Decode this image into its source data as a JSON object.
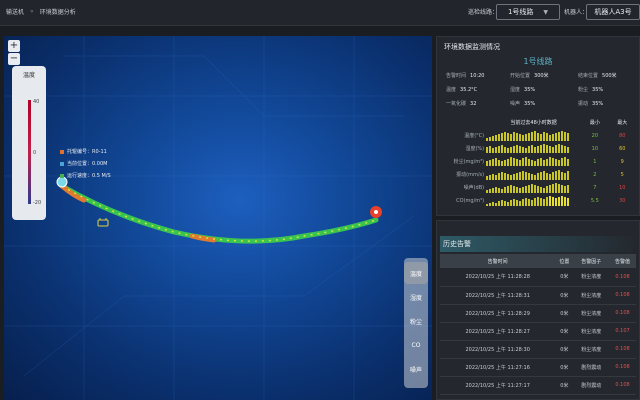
{
  "breadcrumb": {
    "root": "输送机",
    "separator": "»",
    "current": "环境数据分析"
  },
  "header": {
    "route_label": "巡检线路：",
    "route_value": "1号线路",
    "robot_label": "机器人：",
    "robot_value": "机器人A3号"
  },
  "map": {
    "zoom_in": "+",
    "zoom_out": "−",
    "legend": {
      "title": "温度",
      "max": "40",
      "zero": "0",
      "min": "-20"
    },
    "info": [
      {
        "label": "托辊编号：R0-11",
        "color": "#e07030"
      },
      {
        "label": "当前位置：0.00M",
        "color": "#4aa3d8"
      },
      {
        "label": "运行速度：0.5 M/S",
        "color": "#4caf50"
      }
    ],
    "side_buttons": [
      "温度",
      "湿度",
      "粉尘",
      "CO",
      "噪声"
    ],
    "active_button": "温度"
  },
  "monitor": {
    "title": "环境数据监测情况",
    "route": "1号线路",
    "fields": [
      {
        "label": "告警时间",
        "value": "10:20"
      },
      {
        "label": "开始位置",
        "value": "300米"
      },
      {
        "label": "结束位置",
        "value": "500米"
      },
      {
        "label": "温度",
        "value": "35.2°C"
      },
      {
        "label": "湿度",
        "value": "35%"
      },
      {
        "label": "粉尘",
        "value": "35%"
      },
      {
        "label": "一氧化碳",
        "value": "32"
      },
      {
        "label": "噪声",
        "value": "35%"
      },
      {
        "label": "振动",
        "value": "35%"
      }
    ],
    "table_header": {
      "name": "",
      "trend": "当前过去48小时数据",
      "min": "最小",
      "max": "最大"
    },
    "rows": [
      {
        "name": "温度(°C)",
        "min": "20",
        "max": "80",
        "min_color": "#7fbf3a",
        "max_color": "#e04040"
      },
      {
        "name": "湿度(%)",
        "min": "10",
        "max": "60",
        "min_color": "#7fbf3a",
        "max_color": "#e0c030"
      },
      {
        "name": "粉尘(mg/m³)",
        "min": "1",
        "max": "9",
        "min_color": "#7fbf3a",
        "max_color": "#e0c030"
      },
      {
        "name": "振动(mm/s)",
        "min": "2",
        "max": "5",
        "min_color": "#7fbf3a",
        "max_color": "#e0c030"
      },
      {
        "name": "噪声(dB)",
        "min": "7",
        "max": "10",
        "min_color": "#7fbf3a",
        "max_color": "#e04040"
      },
      {
        "name": "CO(mg/m³)",
        "min": "5.5",
        "max": "30",
        "min_color": "#7fbf3a",
        "max_color": "#e04040"
      }
    ]
  },
  "history": {
    "title": "历史告警",
    "columns": [
      "告警时间",
      "位置",
      "告警因子",
      "告警值"
    ],
    "rows": [
      [
        "2022/10/25 上午 11:28:28",
        "0米",
        "粉尘浓度",
        "0.108"
      ],
      [
        "2022/10/25 上午 11:28:31",
        "0米",
        "粉尘浓度",
        "0.108"
      ],
      [
        "2022/10/25 上午 11:28:29",
        "0米",
        "粉尘浓度",
        "0.108"
      ],
      [
        "2022/10/25 上午 11:28:27",
        "0米",
        "粉尘浓度",
        "0.107"
      ],
      [
        "2022/10/25 上午 11:28:30",
        "0米",
        "粉尘浓度",
        "0.108"
      ],
      [
        "2022/10/25 上午 11:27:16",
        "0米",
        "剧烈震动",
        "0.108"
      ],
      [
        "2022/10/25 上午 11:27:17",
        "0米",
        "剧烈震动",
        "0.108"
      ]
    ]
  },
  "colors": {
    "accent": "#5fb2c6",
    "alarm": "#e05050",
    "track_ok": "#3fd048",
    "track_warn": "#e07a30",
    "marker": "#e8402a"
  }
}
